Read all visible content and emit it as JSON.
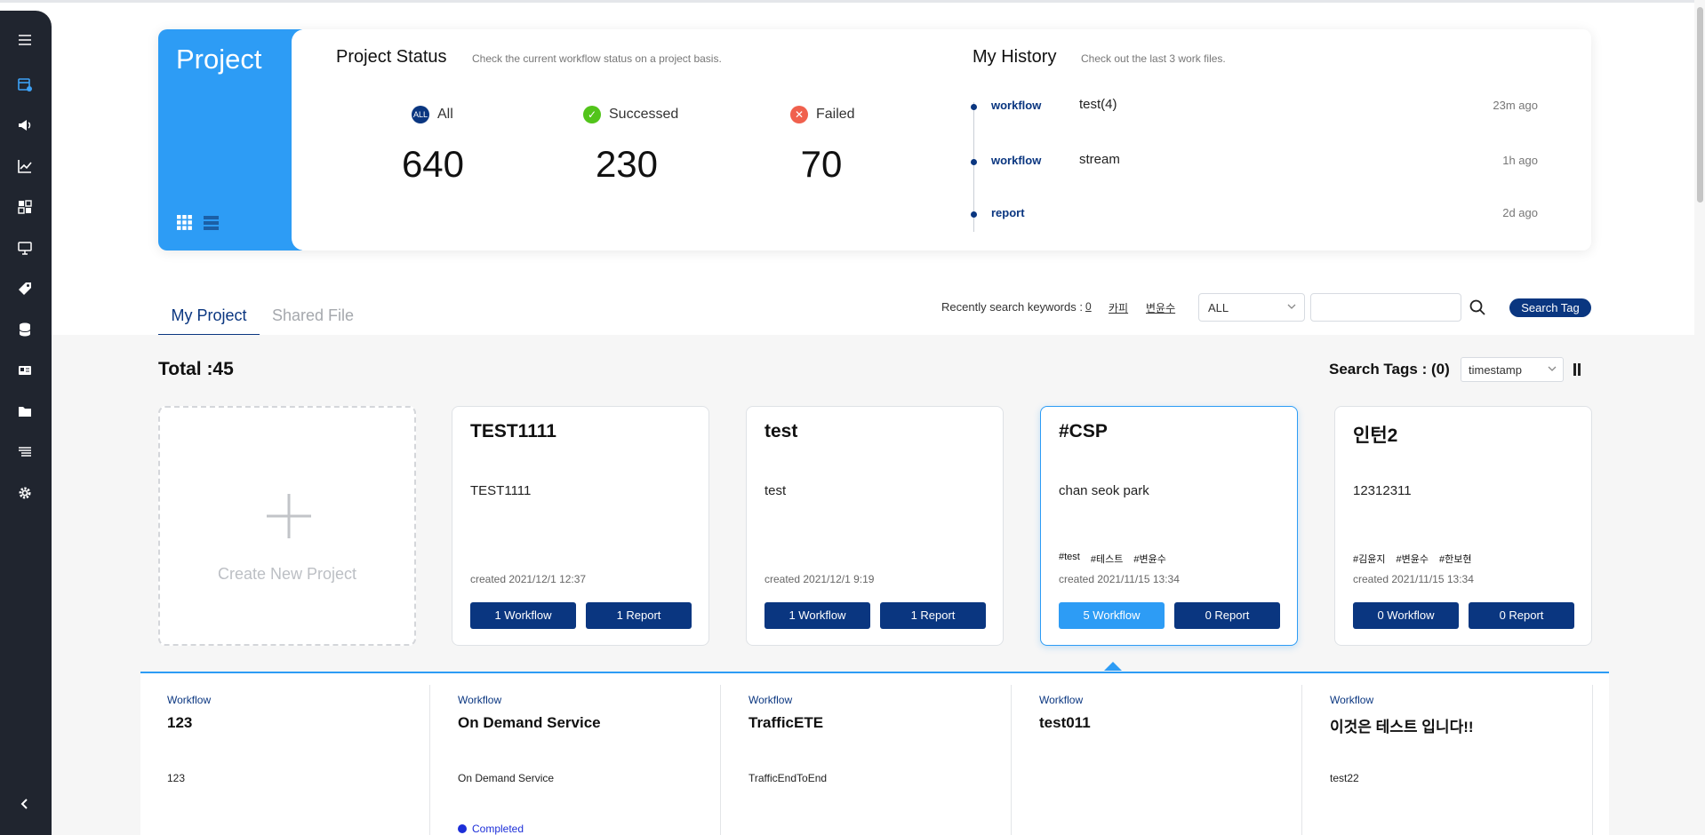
{
  "project_panel": {
    "title": "Project"
  },
  "project_status": {
    "title": "Project Status",
    "subtitle": "Check the current workflow status on a project basis.",
    "stats": [
      {
        "label": "All",
        "value": "640",
        "badge": "ALL",
        "color": "#0a3680"
      },
      {
        "label": "Successed",
        "value": "230",
        "badge": "✓",
        "color": "#52c41a"
      },
      {
        "label": "Failed",
        "value": "70",
        "badge": "✕",
        "color": "#f0604d"
      }
    ]
  },
  "history": {
    "title": "My History",
    "subtitle": "Check out the last 3 work files.",
    "items": [
      {
        "type": "workflow",
        "name": "test(4)",
        "time": "23m ago"
      },
      {
        "type": "workflow",
        "name": "stream",
        "time": "1h ago"
      },
      {
        "type": "report",
        "name": "",
        "time": "2d ago"
      }
    ]
  },
  "tabs": {
    "my_project": "My Project",
    "shared_file": "Shared File"
  },
  "search": {
    "recent_label": "Recently search keywords :",
    "keywords": [
      "0",
      "카피",
      "변윤수"
    ],
    "filter_value": "ALL",
    "query": "",
    "button_label": "Search Tag"
  },
  "total": {
    "label": "Total :45"
  },
  "tag_filter": {
    "label": "Search Tags : (0)",
    "sort_value": "timestamp"
  },
  "create_card": {
    "label": "Create New Project"
  },
  "projects": [
    {
      "title": "TEST1111",
      "desc": "TEST1111",
      "tags": [],
      "created": "created    2021/12/1 12:37",
      "workflow_btn": "1 Workflow",
      "report_btn": "1 Report"
    },
    {
      "title": "test",
      "desc": "test",
      "tags": [],
      "created": "created    2021/12/1 9:19",
      "workflow_btn": "1 Workflow",
      "report_btn": "1 Report"
    },
    {
      "title": "#CSP",
      "desc": "chan seok park",
      "tags": [
        "#test",
        "#테스트",
        "#변윤수"
      ],
      "created": "created    2021/11/15 13:34",
      "workflow_btn": "5 Workflow",
      "report_btn": "0 Report"
    },
    {
      "title": "인턴2",
      "desc": "12312311",
      "tags": [
        "#김윤지",
        "#변윤수",
        "#한보현"
      ],
      "created": "created    2021/11/15 13:34",
      "workflow_btn": "0 Workflow",
      "report_btn": "0 Report"
    }
  ],
  "workflows": [
    {
      "kind": "Workflow",
      "title": "123",
      "desc": "123",
      "status": ""
    },
    {
      "kind": "Workflow",
      "title": "On Demand Service",
      "desc": "On Demand Service",
      "status": "Completed"
    },
    {
      "kind": "Workflow",
      "title": "TrafficETE",
      "desc": "TrafficEndToEnd",
      "status": ""
    },
    {
      "kind": "Workflow",
      "title": "test011",
      "desc": "",
      "status": ""
    },
    {
      "kind": "Workflow",
      "title": "이것은 테스트 입니다!!",
      "desc": "test22",
      "status": ""
    }
  ],
  "sidebar": {
    "icons": [
      "menu-icon",
      "calendar-icon",
      "megaphone-icon",
      "chart-icon",
      "grid-icon",
      "monitor-icon",
      "tag-icon",
      "database-icon",
      "card-icon",
      "folder-icon",
      "list-icon",
      "gear-icon",
      "collapse-icon"
    ]
  }
}
